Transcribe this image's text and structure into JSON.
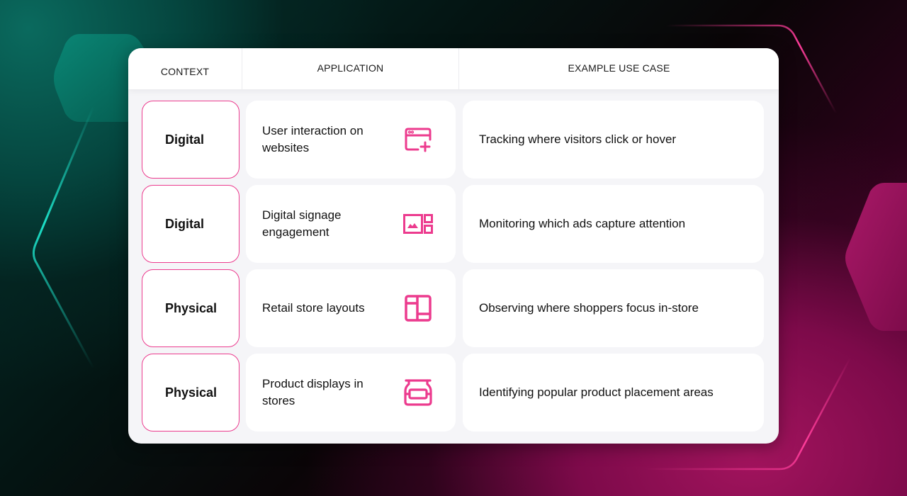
{
  "colors": {
    "accent_pink": "#ec3b8e",
    "teal_line": "#1de0c8",
    "text": "#111111"
  },
  "table": {
    "headers": {
      "context": "CONTEXT",
      "application": "APPLICATION",
      "usecase": "EXAMPLE USE CASE"
    },
    "rows": [
      {
        "context": "Digital",
        "application": "User interaction on websites",
        "icon": "browser-window-plus-icon",
        "usecase": "Tracking where visitors click or hover"
      },
      {
        "context": "Digital",
        "application": "Digital signage engagement",
        "icon": "image-gallery-icon",
        "usecase": "Monitoring which ads capture attention"
      },
      {
        "context": "Physical",
        "application": "Retail store layouts",
        "icon": "layout-grid-icon",
        "usecase": "Observing where shoppers focus in-store"
      },
      {
        "context": "Physical",
        "application": "Product displays in stores",
        "icon": "jar-product-icon",
        "usecase": "Identifying popular product placement areas"
      }
    ]
  }
}
